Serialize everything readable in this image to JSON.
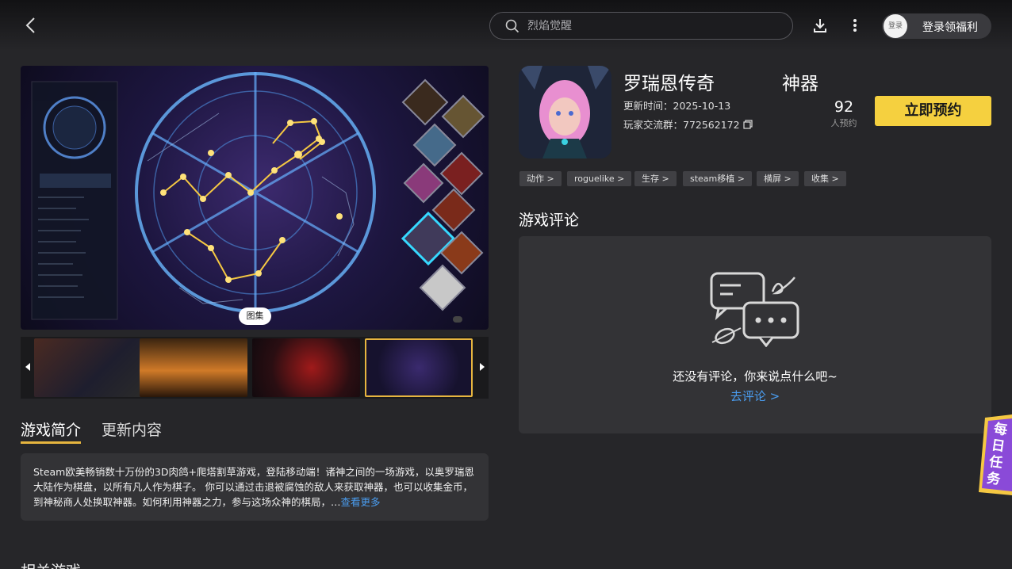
{
  "search": {
    "placeholder": "烈焰觉醒"
  },
  "header": {
    "login_avatar_text": "登录",
    "login_label": "登录领福利"
  },
  "gallery": {
    "badge": "图集"
  },
  "tabs": [
    {
      "label": "游戏简介",
      "active": true
    },
    {
      "label": "更新内容",
      "active": false
    }
  ],
  "description": {
    "text": "Steam欧美畅销数十万份的3D肉鸽+爬塔割草游戏，登陆移动端！诸神之间的一场游戏，以奥罗瑞恩大陆作为棋盘，以所有凡人作为棋子。 你可以通过击退被腐蚀的敌人来获取神器，也可以收集金币，到神秘商人处换取神器。如何利用神器之力，参与这场众神的棋局，…",
    "more": "查看更多"
  },
  "related_heading": "相关游戏",
  "game": {
    "title": "罗瑞恩传奇",
    "title_suffix": "神器",
    "update_time": "更新时间：2025-10-13",
    "group": "玩家交流群：772562172",
    "reserve_count": "92",
    "reserve_count_label": "人预约",
    "reserve_button": "立即预约"
  },
  "tags": [
    "动作 >",
    "roguelike >",
    "生存 >",
    "steam移植 >",
    "横屏 >",
    "收集 >"
  ],
  "reviews": {
    "heading": "游戏评论",
    "empty_text": "还没有评论，你来说点什么吧~",
    "link": "去评论 >"
  },
  "daily_task": "每日任务",
  "icons": [
    "back-icon",
    "search-icon",
    "download-icon",
    "more-vert-icon",
    "copy-icon",
    "chat-bubbles-icon",
    "arrow-left-icon",
    "arrow-right-icon"
  ],
  "colors": {
    "accent": "#f5d03f",
    "link": "#4a9df0",
    "tab_underline": "#e6b53f",
    "background": "#262629"
  }
}
